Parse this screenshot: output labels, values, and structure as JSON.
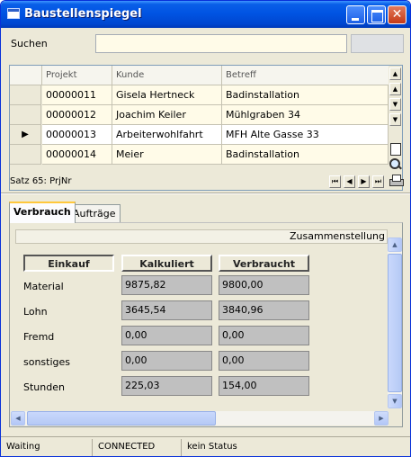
{
  "window": {
    "title": "Baustellenspiegel"
  },
  "search": {
    "label": "Suchen",
    "value": "",
    "secondary_value": ""
  },
  "grid": {
    "columns": [
      "Projekt",
      "Kunde",
      "Betreff"
    ],
    "rows": [
      {
        "indicator": "",
        "projekt": "00000011",
        "kunde": "Gisela Hertneck",
        "betreff": "Badinstallation"
      },
      {
        "indicator": "",
        "projekt": "00000012",
        "kunde": "Joachim Keiler",
        "betreff": "Mühlgraben 34"
      },
      {
        "indicator": "▶",
        "projekt": "00000013",
        "kunde": "Arbeiterwohlfahrt",
        "betreff": "MFH Alte Gasse 33"
      },
      {
        "indicator": "",
        "projekt": "00000014",
        "kunde": "Meier",
        "betreff": "Badinstallation"
      }
    ],
    "status": "Satz 65: PrjNr",
    "selected_row": 2
  },
  "tabs": [
    {
      "label": "Verbrauch",
      "active": true
    },
    {
      "label": "Aufträge",
      "active": false
    }
  ],
  "verbrauch": {
    "header": "Zusammenstellung",
    "columns": [
      "Einkauf",
      "Kalkuliert",
      "Verbraucht"
    ],
    "rows": [
      {
        "label": "Material",
        "kalkuliert": "9875,82",
        "verbraucht": "9800,00"
      },
      {
        "label": "Lohn",
        "kalkuliert": "3645,54",
        "verbraucht": "3840,96"
      },
      {
        "label": "Fremd",
        "kalkuliert": "0,00",
        "verbraucht": "0,00"
      },
      {
        "label": "sonstiges",
        "kalkuliert": "0,00",
        "verbraucht": "0,00"
      },
      {
        "label": "Stunden",
        "kalkuliert": "225,03",
        "verbraucht": "154,00"
      }
    ]
  },
  "statusbar": {
    "state": "Waiting",
    "connection": "CONNECTED",
    "info": "kein Status"
  },
  "colors": {
    "titlebar": "#0054e3",
    "window_bg": "#ece9d8",
    "input_bg": "#fffbe8",
    "value_bg": "#c0c0c0",
    "tab_accent": "#ffc83c"
  }
}
